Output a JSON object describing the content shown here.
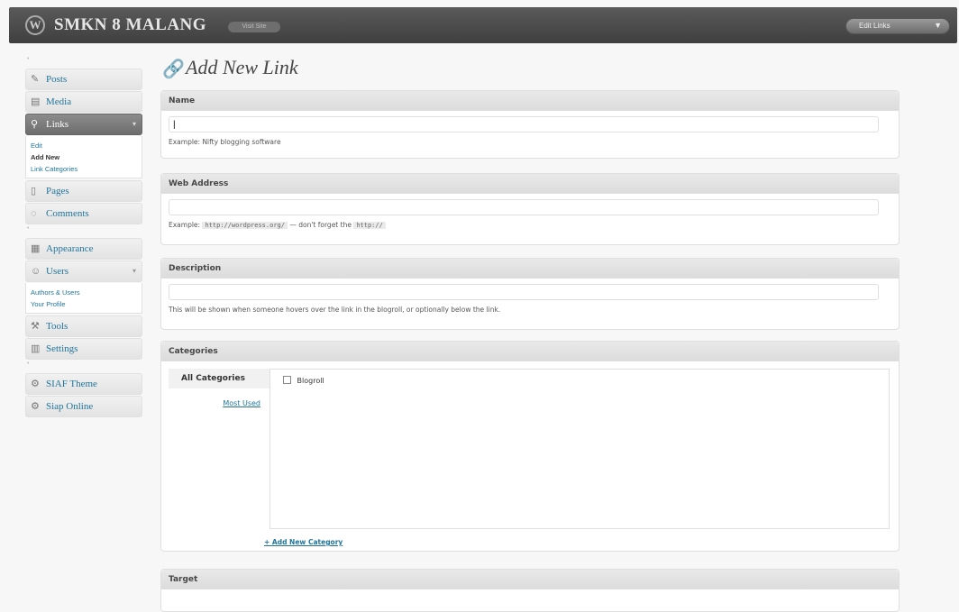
{
  "header": {
    "site_name": "SMKN 8 MALANG",
    "visit_site": "Visit Site",
    "favorite_action": "Edit Links",
    "favorite_arrow": "▼"
  },
  "sidebar": {
    "posts": "Posts",
    "media": "Media",
    "links": "Links",
    "links_sub": [
      "Edit",
      "Add New",
      "Link Categories"
    ],
    "pages": "Pages",
    "comments": "Comments",
    "appearance": "Appearance",
    "users": "Users",
    "users_sub": [
      "Authors & Users",
      "Your Profile"
    ],
    "tools": "Tools",
    "settings": "Settings",
    "siaf_theme": "SIAF Theme",
    "siap_online": "Siap Online"
  },
  "page": {
    "title": "Add New Link"
  },
  "name_box": {
    "title": "Name",
    "value": "|",
    "hint": "Example: Nifty blogging software"
  },
  "web_box": {
    "title": "Web Address",
    "value": "",
    "hint_prefix": "Example:",
    "hint_code1": "http://wordpress.org/",
    "hint_middle": "— don't forget the",
    "hint_code2": "http://"
  },
  "desc_box": {
    "title": "Description",
    "value": "",
    "hint": "This will be shown when someone hovers over the link in the blogroll, or optionally below the link."
  },
  "categories_box": {
    "title": "Categories",
    "tab_all": "All Categories",
    "tab_most": "Most Used",
    "item": "Blogroll",
    "add_new": "+ Add New Category"
  },
  "target_box": {
    "title": "Target"
  }
}
